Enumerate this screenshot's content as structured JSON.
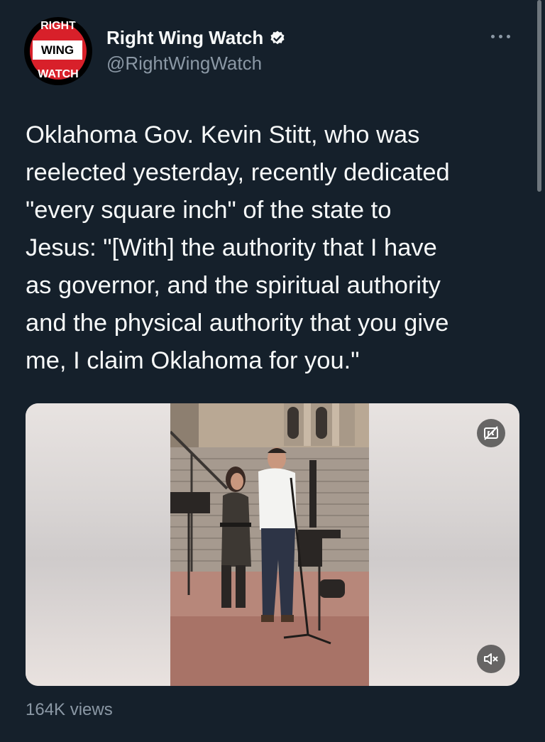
{
  "account": {
    "logo_top": "RIGHT",
    "logo_mid": "WING",
    "logo_bot": "WATCH",
    "name": "Right Wing Watch",
    "handle": "@RightWingWatch",
    "verified_icon": "verified-badge-icon"
  },
  "tweet": {
    "text": "Oklahoma Gov. Kevin Stitt, who was\nreelected yesterday, recently dedicated\n\"every square inch\" of the state to\nJesus: \"[With] the authority that I have\nas governor, and the spiritual authority\nand the physical authority that you give\nme, I claim Oklahoma for you.\""
  },
  "media": {
    "captions_icon": "closed-captions-icon",
    "mute_icon": "volume-muted-icon"
  },
  "stats": {
    "views": "164K views"
  },
  "colors": {
    "background": "#15202b",
    "text": "#f7f9f9",
    "secondary": "#8b98a5",
    "brand_red": "#d8202a",
    "verified_blue": "#ffffff"
  }
}
